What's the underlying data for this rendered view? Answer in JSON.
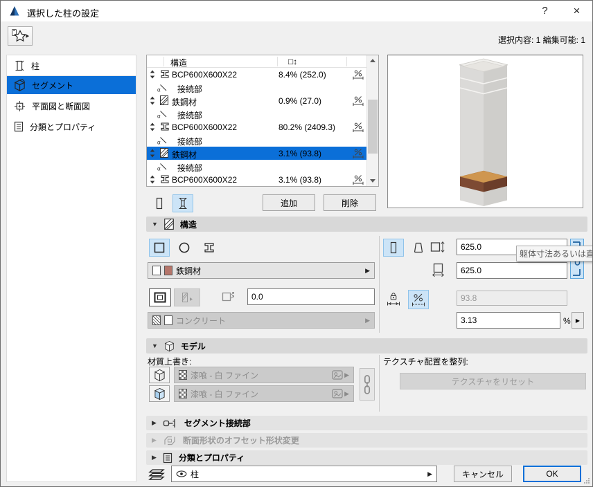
{
  "window": {
    "title": "選択した柱の設定",
    "help_label": "?",
    "close_label": "×",
    "selection_info": "選択内容: 1 編集可能: 1"
  },
  "sidebar": {
    "items": [
      {
        "label": "柱"
      },
      {
        "label": "セグメント"
      },
      {
        "label": "平面図と断面図"
      },
      {
        "label": "分類とプロパティ"
      }
    ]
  },
  "segments": {
    "header_structure": "構造",
    "header_length": "□↕",
    "rows": [
      {
        "name": "BCP600X600X22",
        "value": "8.4% (252.0)"
      },
      {
        "name": "接続部"
      },
      {
        "name": "鉄鋼材",
        "value": "0.9% (27.0)"
      },
      {
        "name": "接続部"
      },
      {
        "name": "BCP600X600X22",
        "value": "80.2% (2409.3)"
      },
      {
        "name": "接続部"
      },
      {
        "name": "鉄鋼材",
        "value": "3.1% (93.8)"
      },
      {
        "name": "接続部"
      },
      {
        "name": "BCP600X600X22",
        "value": "3.1% (93.8)"
      }
    ],
    "add_label": "追加",
    "delete_label": "削除"
  },
  "structure": {
    "title": "構造",
    "material": "鉄鋼材",
    "veneer_offset": "0.0",
    "core_material": "コンクリート",
    "height_value": "625.0",
    "width_value": "625.0",
    "tooltip": "躯体寸法あるいは直径",
    "fixed_length": "93.8",
    "percent": "3.13",
    "percent_unit": "%"
  },
  "model": {
    "title": "モデル",
    "override_label": "材質上書き:",
    "surface_top": "漆喰 - 白 ファイン",
    "surface_side": "漆喰 - 白 ファイン",
    "texture_label": "テクスチャ配置を整列:",
    "reset_label": "テクスチャをリセット"
  },
  "panels": {
    "segment_joint": "セグメント接続部",
    "profile_offset": "断面形状のオフセット形状変更",
    "classification": "分類とプロパティ"
  },
  "footer": {
    "layer": "柱",
    "cancel_label": "キャンセル",
    "ok_label": "OK"
  },
  "glyphs": {
    "collapse_open": "▼",
    "collapse_closed": "▶",
    "menu_arrow": "▶"
  },
  "colors": {
    "selection": "#0b6fd8",
    "toggle_bg": "#cce4f7",
    "swatch_red": "#b5756a"
  }
}
